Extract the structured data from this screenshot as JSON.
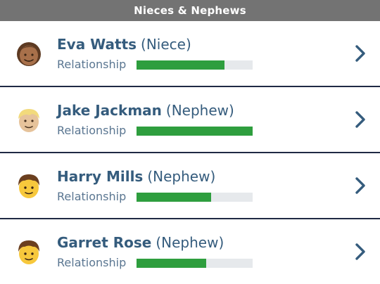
{
  "header": {
    "title": "Nieces & Nephews"
  },
  "relationship_label": "Relationship",
  "colors": {
    "header_bg": "#737373",
    "name_text": "#355c7d",
    "bar_fill": "#2e9e3e",
    "bar_track": "#e6e9ec",
    "divider": "#1f2a44"
  },
  "people": [
    {
      "name": "Eva Watts",
      "relation": "(Niece)",
      "relationship_level": 0.76,
      "avatar_icon": "brown-skin-woman-face-icon"
    },
    {
      "name": "Jake Jackman",
      "relation": "(Nephew)",
      "relationship_level": 1.0,
      "avatar_icon": "blond-man-face-icon"
    },
    {
      "name": "Harry Mills",
      "relation": "(Nephew)",
      "relationship_level": 0.64,
      "avatar_icon": "brown-hair-boy-face-icon"
    },
    {
      "name": "Garret Rose",
      "relation": "(Nephew)",
      "relationship_level": 0.6,
      "avatar_icon": "brown-hair-boy-face-icon"
    }
  ]
}
